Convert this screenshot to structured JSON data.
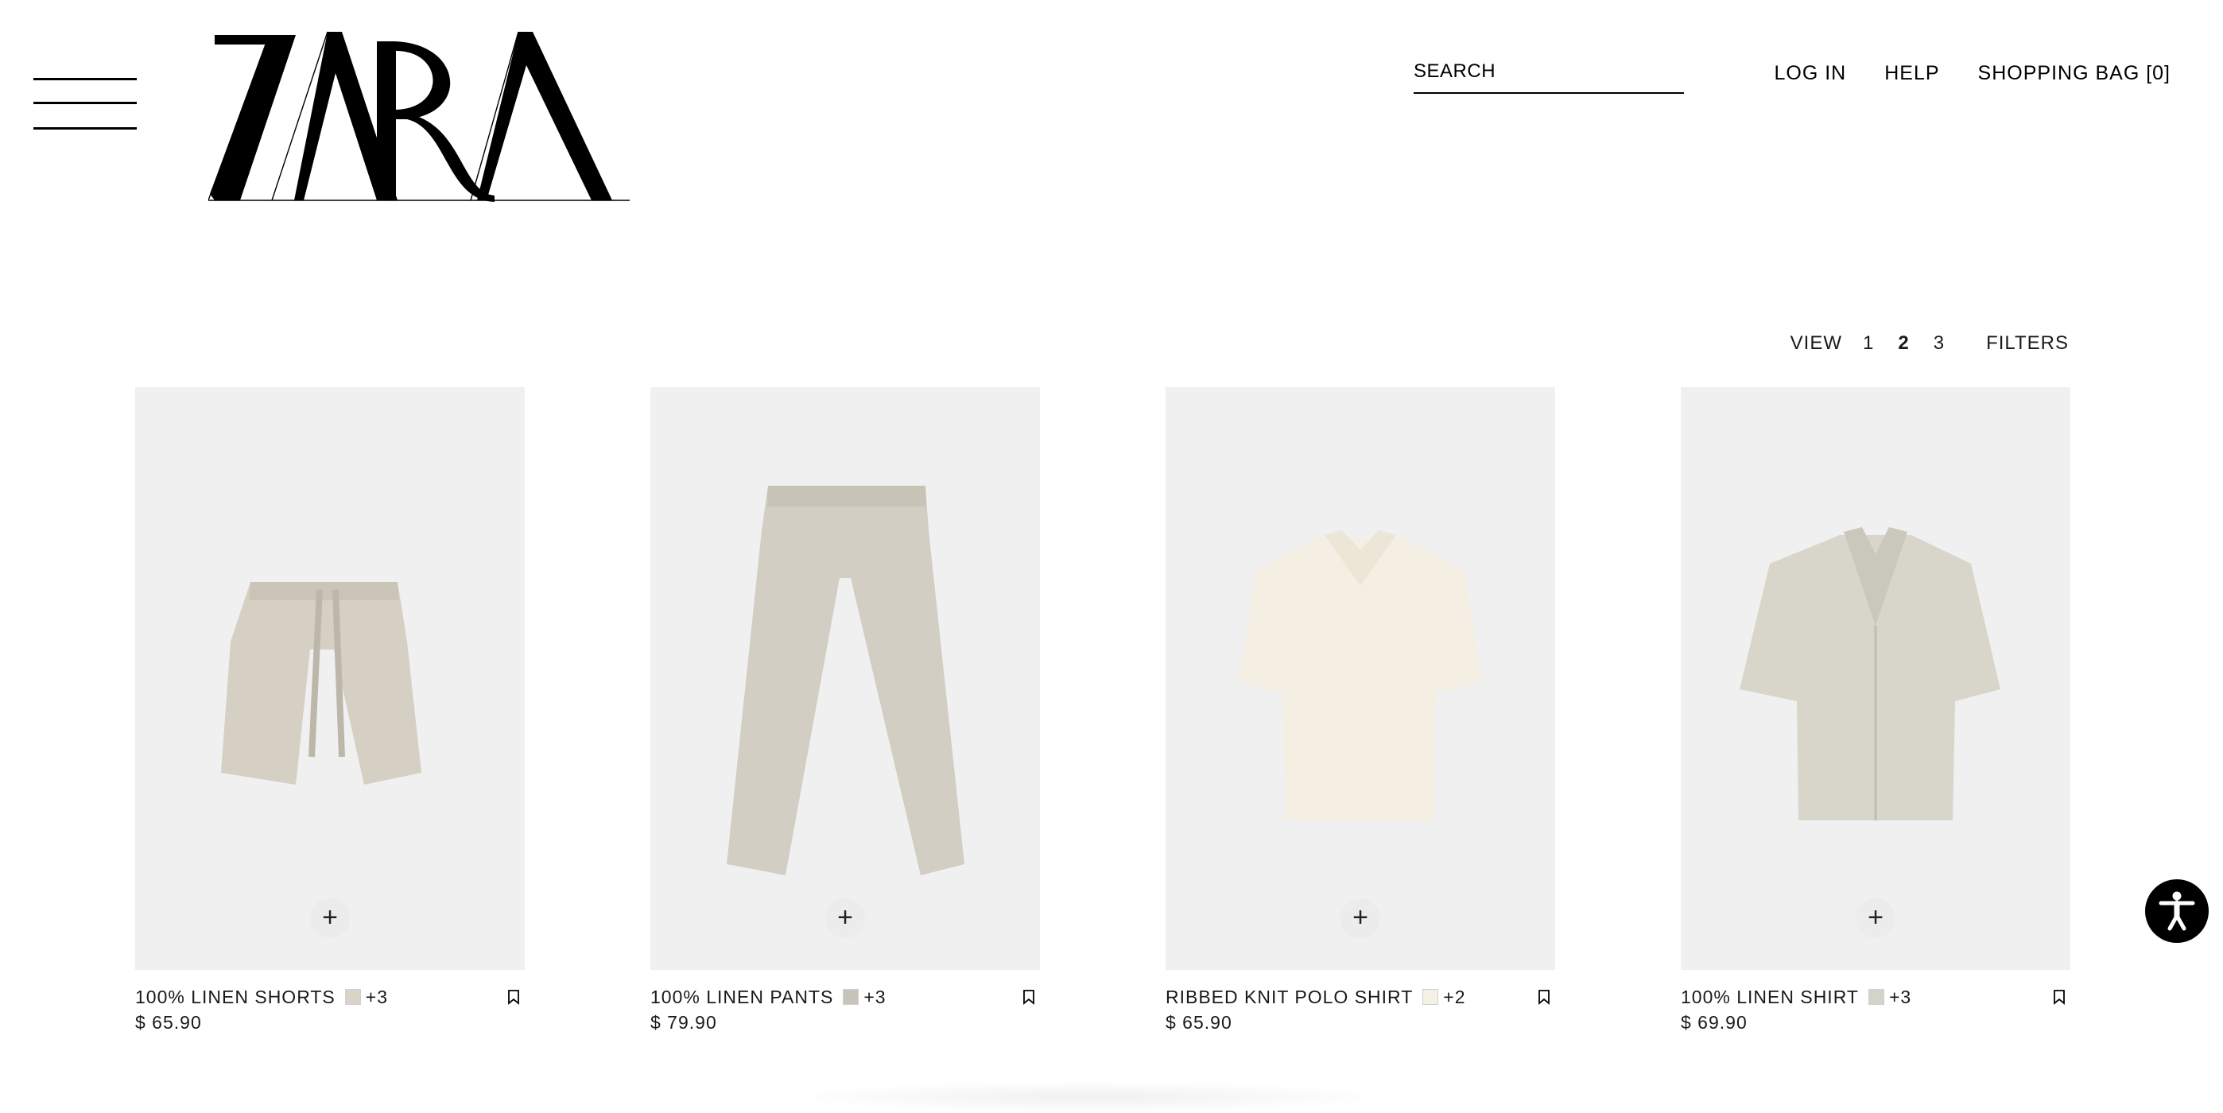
{
  "brand": {
    "logo_text": "ZARA"
  },
  "search": {
    "placeholder": "SEARCH"
  },
  "nav": {
    "login": "LOG IN",
    "help": "HELP",
    "bag": "SHOPPING BAG [0]"
  },
  "view_bar": {
    "label": "VIEW",
    "options": [
      "1",
      "2",
      "3"
    ],
    "active": "2",
    "filters": "FILTERS"
  },
  "products": [
    {
      "name": "100% LINEN SHORTS",
      "swatch_color": "#d9d3c8",
      "more_colors": "+3",
      "price": "$ 65.90"
    },
    {
      "name": "100% LINEN PANTS",
      "swatch_color": "#c6c4bb",
      "more_colors": "+3",
      "price": "$ 79.90"
    },
    {
      "name": "RIBBED KNIT POLO SHIRT",
      "swatch_color": "#f6f1e7",
      "more_colors": "+2",
      "price": "$ 65.90"
    },
    {
      "name": "100% LINEN SHIRT",
      "swatch_color": "#d4d3ca",
      "more_colors": "+3",
      "price": "$ 69.90"
    }
  ],
  "icons": {
    "menu": "hamburger-menu-icon",
    "add": "plus-icon",
    "bookmark": "bookmark-icon",
    "accessibility": "accessibility-icon"
  },
  "colors": {
    "background": "#ffffff",
    "text": "#1a1a1a",
    "image_bg": "#f0f0f0",
    "accent": "#000000"
  }
}
